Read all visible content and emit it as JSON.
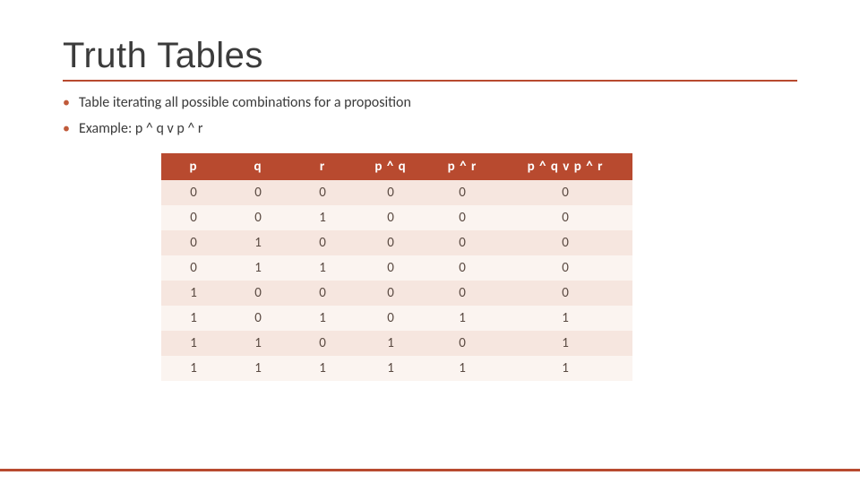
{
  "title": "Truth Tables",
  "bullets": [
    "Table iterating all possible combinations for a proposition",
    "Example: p ^ q v p ^ r"
  ],
  "table": {
    "headers": [
      "p",
      "q",
      "r",
      "p ^ q",
      "p ^ r",
      "p ^ q v p ^ r"
    ],
    "rows": [
      [
        "0",
        "0",
        "0",
        "0",
        "0",
        "0"
      ],
      [
        "0",
        "0",
        "1",
        "0",
        "0",
        "0"
      ],
      [
        "0",
        "1",
        "0",
        "0",
        "0",
        "0"
      ],
      [
        "0",
        "1",
        "1",
        "0",
        "0",
        "0"
      ],
      [
        "1",
        "0",
        "0",
        "0",
        "0",
        "0"
      ],
      [
        "1",
        "0",
        "1",
        "0",
        "1",
        "1"
      ],
      [
        "1",
        "1",
        "0",
        "1",
        "0",
        "1"
      ],
      [
        "1",
        "1",
        "1",
        "1",
        "1",
        "1"
      ]
    ]
  }
}
